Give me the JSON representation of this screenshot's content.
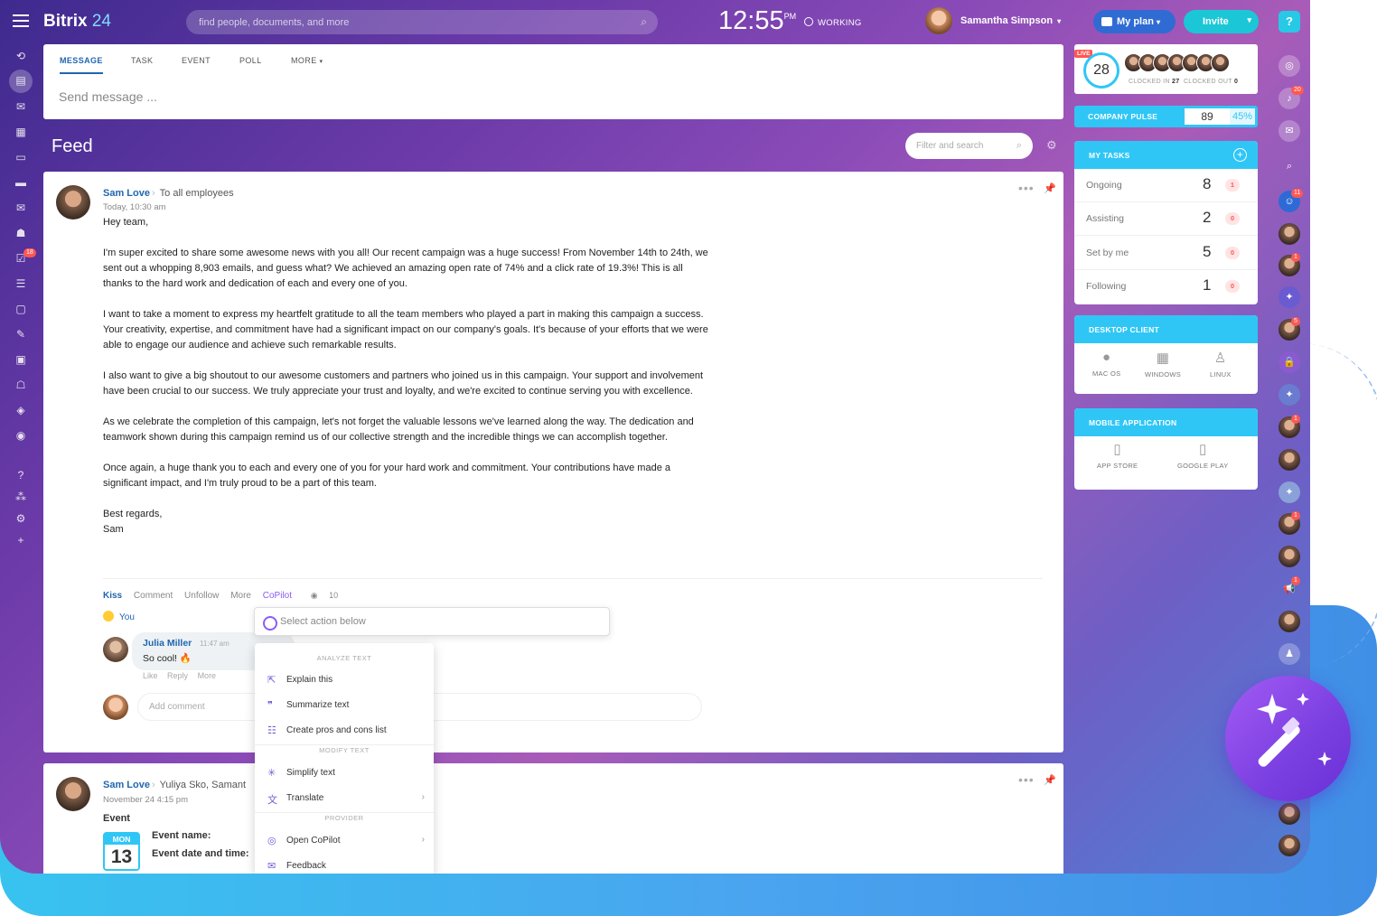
{
  "app": {
    "logo_main": "Bitrix",
    "logo_num": "24"
  },
  "header": {
    "search_placeholder": "find people, documents, and more",
    "clock": "12:55",
    "ampm": "PM",
    "status": "WORKING",
    "user_name": "Samantha Simpson",
    "my_plan": "My plan",
    "invite": "Invite",
    "help": "?"
  },
  "left_sidebar": {
    "tasks_badge": "18"
  },
  "composer": {
    "tabs": [
      "MESSAGE",
      "TASK",
      "EVENT",
      "POLL",
      "MORE"
    ],
    "placeholder": "Send message ..."
  },
  "feed": {
    "title": "Feed",
    "filter_placeholder": "Filter and search"
  },
  "post1": {
    "author": "Sam Love",
    "recipients": "To all employees",
    "time": "Today, 10:30 am",
    "paragraphs": [
      "Hey team,",
      "I'm super excited to share some awesome news with you all! Our recent campaign was a huge success! From November 14th to 24th, we sent out a whopping 8,903 emails, and guess what? We achieved an amazing open rate of 74% and a click rate of 19.3%! This is all thanks to the hard work and dedication of each and every one of you.",
      "I want to take a moment to express my heartfelt gratitude to all the team members who played a part in making this campaign a success. Your creativity, expertise, and commitment have had a significant impact on our company's goals. It's because of your efforts that we were able to engage our audience and achieve such remarkable results.",
      "I also want to give a big shoutout to our awesome customers and partners who joined us in this campaign. Your support and involvement have been crucial to our success. We truly appreciate your trust and loyalty, and we're excited to continue serving you with excellence.",
      "As we celebrate the completion of this campaign, let's not forget the valuable lessons we've learned along the way. The dedication and teamwork shown during this campaign remind us of our collective strength and the incredible things we can accomplish together.",
      "Once again, a huge thank you to each and every one of you for your hard work and commitment. Your contributions have made a significant impact, and I'm truly proud to be a part of this team.",
      "Best regards,",
      "Sam"
    ],
    "actions": {
      "kiss": "Kiss",
      "comment": "Comment",
      "unfollow": "Unfollow",
      "more": "More",
      "copilot": "CoPilot",
      "views": "10"
    },
    "reaction": "You",
    "comment": {
      "author": "Julia Miller",
      "time": "11:47 am",
      "text": "So cool! 🔥",
      "like": "Like",
      "reply": "Reply",
      "more": "More"
    },
    "add_comment_placeholder": "Add comment"
  },
  "copilot": {
    "select_placeholder": "Select action below",
    "sections": {
      "analyze": "ANALYZE TEXT",
      "modify": "MODIFY TEXT",
      "provider": "PROVIDER"
    },
    "items": {
      "explain": "Explain this",
      "summarize": "Summarize text",
      "proscons": "Create pros and cons list",
      "simplify": "Simplify text",
      "translate": "Translate",
      "open": "Open CoPilot",
      "feedback": "Feedback"
    }
  },
  "post2": {
    "author": "Sam Love",
    "recipients": "Yuliya Sko, Samant",
    "time": "November 24 4:15 pm",
    "type": "Event",
    "event_name_label": "Event name:",
    "event_date_label": "Event date and time:",
    "cal_month": "MON",
    "cal_day": "13"
  },
  "timeman": {
    "live": "LIVE",
    "count": "28",
    "clocked_in_label": "CLOCKED IN",
    "clocked_in": "27",
    "clocked_out_label": "CLOCKED OUT",
    "clocked_out": "0"
  },
  "pulse": {
    "label": "COMPANY PULSE",
    "value": "89",
    "percent": "45%"
  },
  "my_tasks": {
    "title": "MY TASKS",
    "rows": [
      {
        "label": "Ongoing",
        "count": "8",
        "badge": "1"
      },
      {
        "label": "Assisting",
        "count": "2",
        "badge": "0"
      },
      {
        "label": "Set by me",
        "count": "5",
        "badge": "0"
      },
      {
        "label": "Following",
        "count": "1",
        "badge": "0"
      }
    ]
  },
  "desktop_client": {
    "title": "DESKTOP CLIENT",
    "mac": "MAC OS",
    "windows": "WINDOWS",
    "linux": "LINUX"
  },
  "mobile_app": {
    "title": "MOBILE APPLICATION",
    "app_store": "APP STORE",
    "google_play": "GOOGLE PLAY"
  },
  "right_sidebar": {
    "notif_badge": "20",
    "chat_badge": "11",
    "b1": "1",
    "b2": "5",
    "b3": "1",
    "b4": "1",
    "b5": "1"
  },
  "colors": {
    "accent": "#2fc6f6",
    "link": "#2066b0",
    "copilot": "#8b5cf6",
    "badge": "#ff5752"
  }
}
